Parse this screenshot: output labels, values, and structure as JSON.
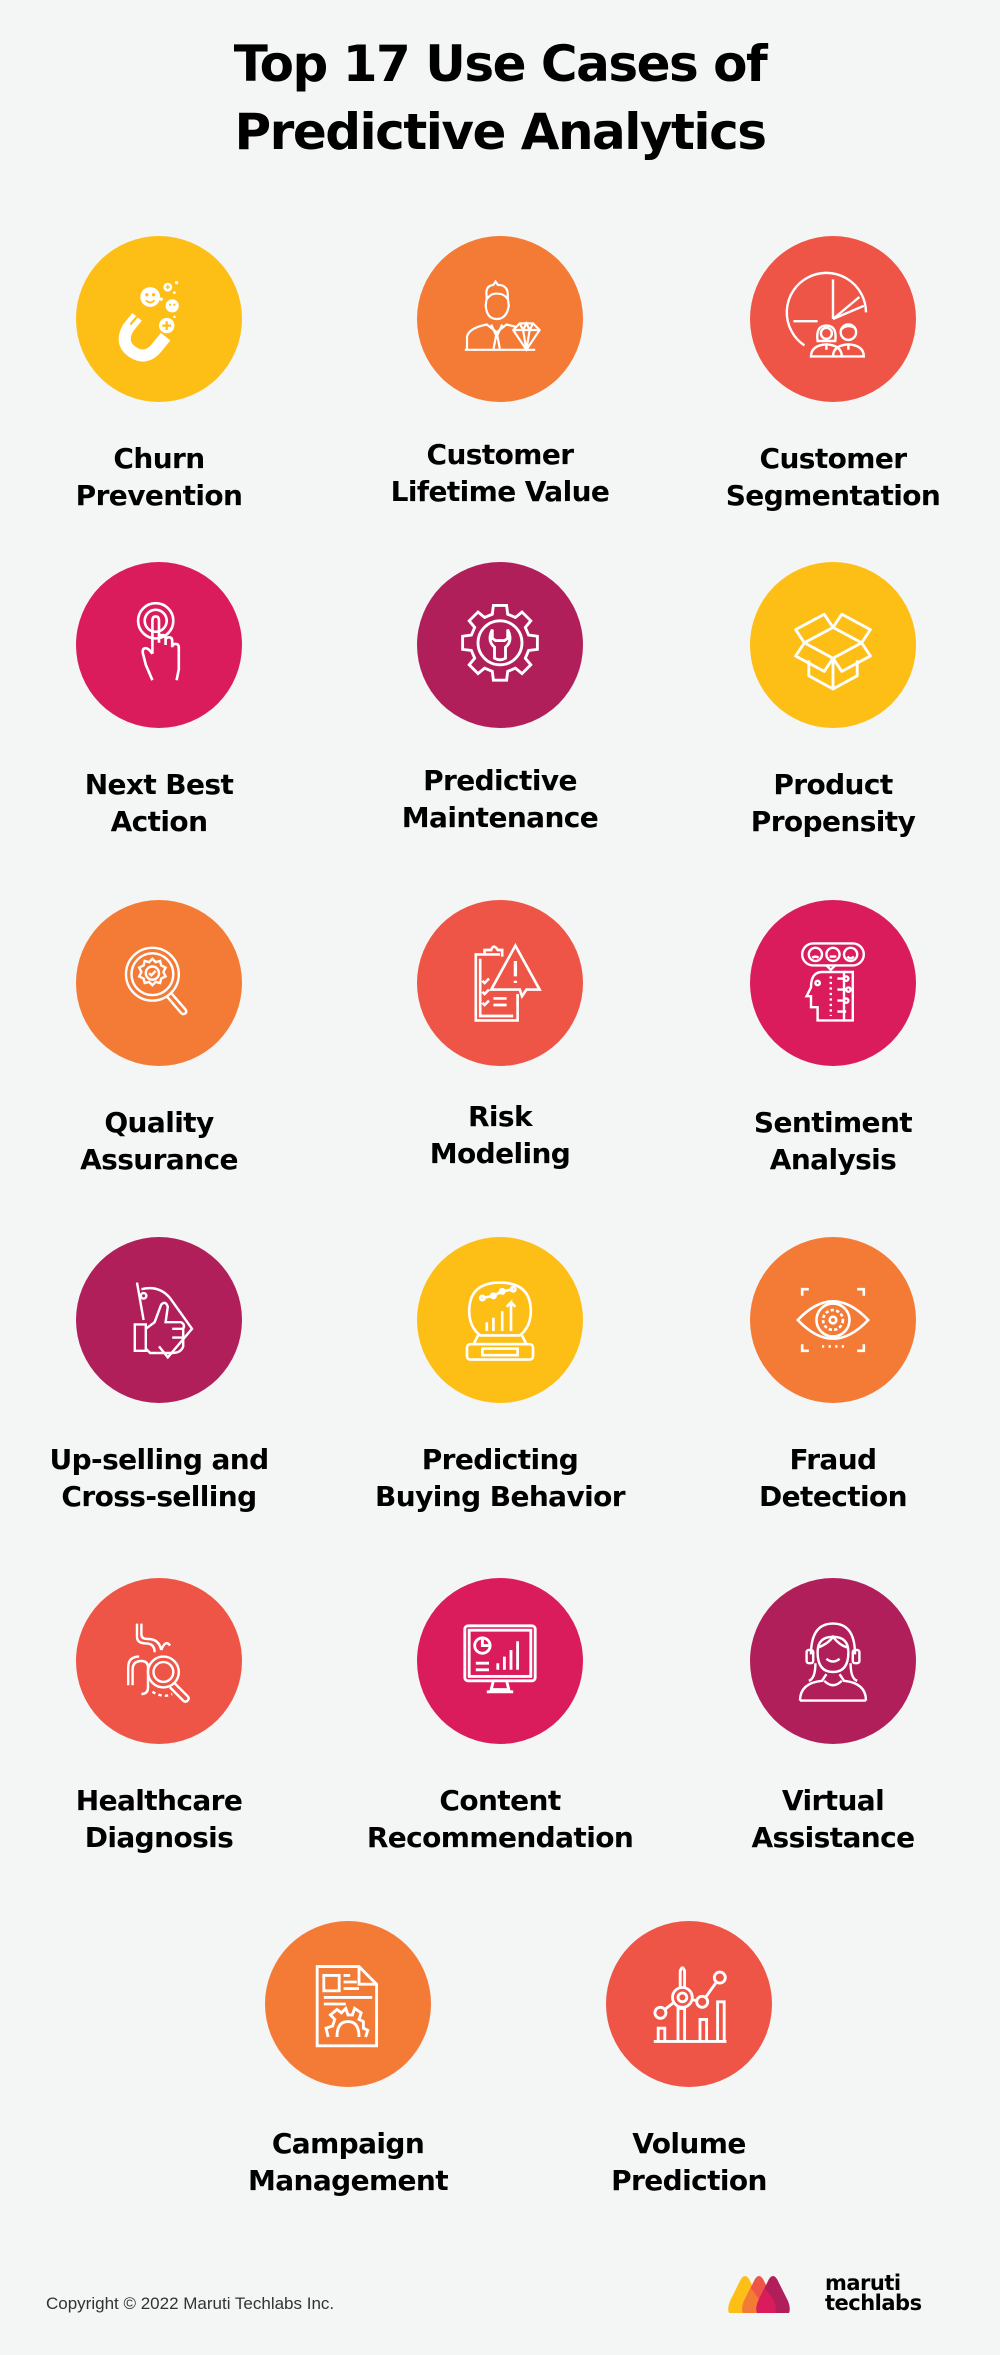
{
  "title": {
    "line1": "Top 17 Use Cases of",
    "line2": "Predictive Analytics"
  },
  "colors": {
    "background": "#f4f5f5",
    "yellow": "#fdbe16",
    "orange": "#f47b36",
    "coral": "#ef5547",
    "pink": "#da1c5c",
    "plum": "#b11f5b"
  },
  "use_cases": [
    {
      "line1": "Churn",
      "line2": "Prevention",
      "icon": "magnet-smiley-icon",
      "color": "#fdbe16"
    },
    {
      "line1": "Customer",
      "line2": "Lifetime Value",
      "icon": "person-diamond-icon",
      "color": "#f47b36"
    },
    {
      "line1": "Customer",
      "line2": "Segmentation",
      "icon": "pie-chart-people-icon",
      "color": "#ef5547"
    },
    {
      "line1": "Next Best",
      "line2": "Action",
      "icon": "tap-finger-icon",
      "color": "#da1c5c"
    },
    {
      "line1": "Predictive",
      "line2": "Maintenance",
      "icon": "gear-wrench-icon",
      "color": "#b11f5b"
    },
    {
      "line1": "Product",
      "line2": "Propensity",
      "icon": "open-box-icon",
      "color": "#fdbe16"
    },
    {
      "line1": "Quality",
      "line2": "Assurance",
      "icon": "magnifier-badge-icon",
      "color": "#f47b36"
    },
    {
      "line1": "Risk",
      "line2": "Modeling",
      "icon": "clipboard-warning-icon",
      "color": "#ef5547"
    },
    {
      "line1": "Sentiment",
      "line2": "Analysis",
      "icon": "head-emotions-icon",
      "color": "#da1c5c"
    },
    {
      "line1": "Up-selling and",
      "line2": "Cross-selling",
      "icon": "thumbs-up-tag-icon",
      "color": "#b11f5b"
    },
    {
      "line1": "Predicting",
      "line2": "Buying Behavior",
      "icon": "crystal-ball-chart-icon",
      "color": "#fdbe16"
    },
    {
      "line1": "Fraud",
      "line2": "Detection",
      "icon": "eye-scan-icon",
      "color": "#f47b36"
    },
    {
      "line1": "Healthcare",
      "line2": "Diagnosis",
      "icon": "stomach-magnifier-icon",
      "color": "#ef5547"
    },
    {
      "line1": "Content",
      "line2": "Recommendation",
      "icon": "monitor-chart-icon",
      "color": "#da1c5c"
    },
    {
      "line1": "Virtual",
      "line2": "Assistance",
      "icon": "headset-agent-icon",
      "color": "#b11f5b"
    },
    {
      "line1": "Campaign",
      "line2": "Management",
      "icon": "document-gear-icon",
      "color": "#f47b36"
    },
    {
      "line1": "Volume",
      "line2": "Prediction",
      "icon": "bar-line-chart-icon",
      "color": "#ef5547"
    }
  ],
  "footer": {
    "copyright": "Copyright © 2022 Maruti Techlabs Inc.",
    "logo_line1": "maruti",
    "logo_line2": "techlabs"
  }
}
